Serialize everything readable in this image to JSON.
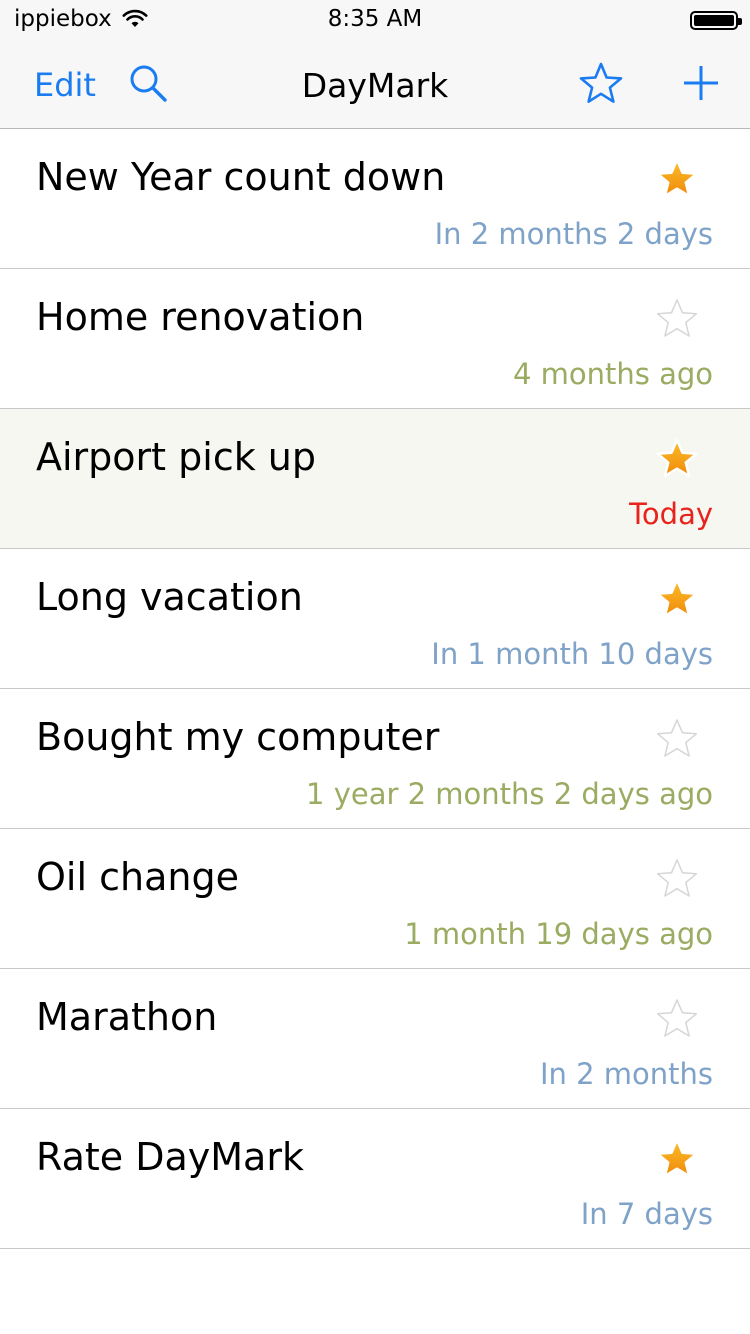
{
  "status_bar": {
    "carrier": "ippiebox",
    "time": "8:35 AM"
  },
  "nav": {
    "edit_label": "Edit",
    "title": "DayMark",
    "icons": [
      "search-icon",
      "star-outline-icon",
      "add-icon"
    ]
  },
  "colors": {
    "accent": "#1a7cf0",
    "future": "#7fa3c8",
    "past": "#9aab62",
    "today": "#e8231c",
    "star_filled": "#f5a213"
  },
  "items": [
    {
      "title": "New Year count down",
      "when": "In 2 months 2 days",
      "status": "future",
      "starred": true
    },
    {
      "title": "Home renovation",
      "when": "4 months ago",
      "status": "past",
      "starred": false
    },
    {
      "title": "Airport pick up",
      "when": "Today",
      "status": "today",
      "starred": true
    },
    {
      "title": "Long vacation",
      "when": "In 1 month 10 days",
      "status": "future",
      "starred": true
    },
    {
      "title": "Bought my computer",
      "when": "1 year 2 months 2 days ago",
      "status": "past",
      "starred": false
    },
    {
      "title": "Oil change",
      "when": "1 month 19 days ago",
      "status": "past",
      "starred": false
    },
    {
      "title": "Marathon",
      "when": "In 2 months",
      "status": "future",
      "starred": false
    },
    {
      "title": "Rate DayMark",
      "when": "In 7 days",
      "status": "future",
      "starred": true
    }
  ]
}
